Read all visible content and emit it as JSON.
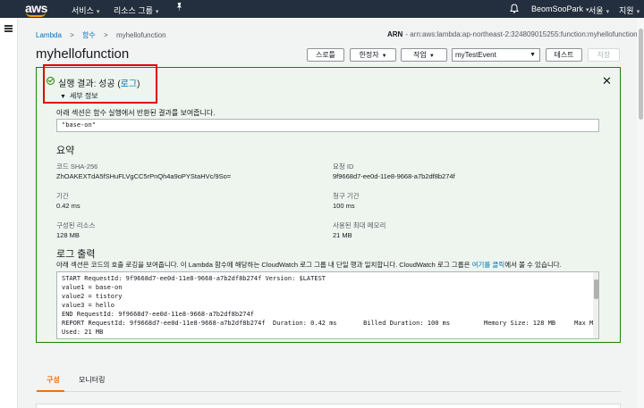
{
  "topbar": {
    "logo": "aws",
    "services": "서비스",
    "resource_groups": "리소스 그룹",
    "pin_icon": "pushpin-icon",
    "bell_icon": "bell-icon",
    "user": "BeomSooPark",
    "region": "서울",
    "support": "지원"
  },
  "breadcrumb": {
    "lambda": "Lambda",
    "functions": "함수",
    "current": "myhellofunction",
    "separator": ">"
  },
  "arn": {
    "label": "ARN",
    "value": "- arn:aws:lambda:ap-northeast-2:324809015255:function:myhellofunction"
  },
  "page_title": "myhellofunction",
  "toolbar": {
    "throttle": "스로틀",
    "qualifiers": "한정자",
    "actions": "작업",
    "test_event": "myTestEvent",
    "test": "테스트",
    "save": "저장"
  },
  "result": {
    "status_prefix": "실행 결과: 성공 (",
    "log_link": "로그",
    "status_suffix": ")",
    "details": "세부 정보",
    "return_desc": "아래 섹션은 함수 실행에서 반환된 결과를 보여줍니다.",
    "return_value": "\"base-on\"",
    "summary_title": "요약",
    "code_sha_label": "코드 SHA-256",
    "code_sha_value": "ZhOAKEXTdA5fSHuFLVgCC5rPnQh4a9oPYStaHVc/9So=",
    "request_id_label": "요청 ID",
    "request_id_value": "9f9668d7-ee0d-11e8-9668-a7b2df8b274f",
    "duration_label": "기간",
    "duration_value": "0.42 ms",
    "billed_label": "청구 기간",
    "billed_value": "100 ms",
    "configured_label": "구성된 리소스",
    "configured_value": "128 MB",
    "max_memory_label": "사용된 최대 메모리",
    "max_memory_value": "21 MB",
    "log_title": "로그 출력",
    "log_desc_prefix": "아래 섹션은 코드의 호출 로깅을 보여줍니다. 이 Lambda 함수에 해당하는 CloudWatch 로그 그룹 내 단일 행과 일치합니다. CloudWatch 로그 그룹은 ",
    "log_desc_link": "여기를 클릭",
    "log_desc_suffix": "에서 볼 수 있습니다.",
    "log_lines": [
      "START RequestId: 9f9668d7-ee0d-11e8-9668-a7b2df8b274f Version: $LATEST",
      "value1 = base-on",
      "value2 = tistory",
      "value3 = hello",
      "END RequestId: 9f9668d7-ee0d-11e8-9668-a7b2df8b274f",
      "REPORT RequestId: 9f9668d7-ee0d-11e8-9668-a7b2df8b274f  Duration: 0.42 ms       Billed Duration: 100 ms         Memory Size: 128 MB     Max Memory",
      "Used: 21 MB"
    ]
  },
  "tabs": {
    "config": "구성",
    "monitoring": "모니터링"
  }
}
